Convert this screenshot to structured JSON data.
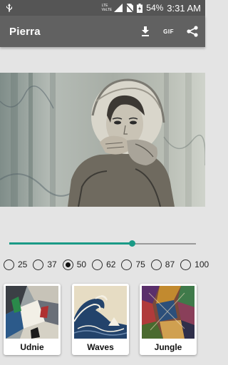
{
  "status_bar": {
    "battery_percent": "54%",
    "time": "3:31 AM",
    "network_lte": "LTE",
    "network_volte": "VoLTE",
    "icons": [
      "usb-icon",
      "signal-icon",
      "no-sim-icon",
      "battery-charging-icon"
    ]
  },
  "app_bar": {
    "title": "Pierra",
    "gif_label": "GIF",
    "actions": [
      "download-icon",
      "gif-icon",
      "share-icon"
    ]
  },
  "slider": {
    "value_fraction": 0.66,
    "accent": "#1a9a86"
  },
  "radio_options": {
    "opt1": "25",
    "opt2": "37",
    "opt3": "50",
    "opt4": "62",
    "opt5": "75",
    "opt6": "87",
    "opt7": "100",
    "selected": "50"
  },
  "styles": {
    "card1": "Udnie",
    "card2": "Waves",
    "card3": "Jungle"
  }
}
